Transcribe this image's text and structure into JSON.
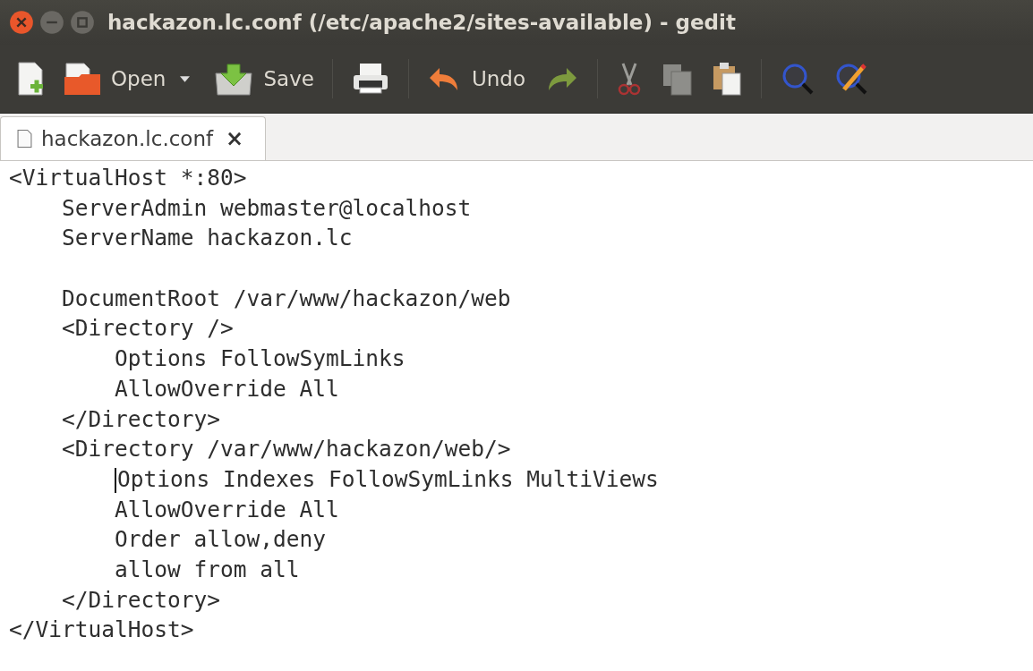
{
  "window": {
    "title": "hackazon.lc.conf (/etc/apache2/sites-available) - gedit"
  },
  "toolbar": {
    "open_label": "Open",
    "save_label": "Save",
    "undo_label": "Undo"
  },
  "tabs": [
    {
      "label": "hackazon.lc.conf",
      "selected": true,
      "close": "×"
    }
  ],
  "editor": {
    "lines": [
      {
        "text": "<VirtualHost *:80>",
        "cursor": false
      },
      {
        "text": "    ServerAdmin webmaster@localhost",
        "cursor": false
      },
      {
        "text": "    ServerName hackazon.lc",
        "cursor": false
      },
      {
        "kind": "blank"
      },
      {
        "text": "    DocumentRoot /var/www/hackazon/web",
        "cursor": false
      },
      {
        "text": "    <Directory />",
        "cursor": false
      },
      {
        "text": "        Options FollowSymLinks",
        "cursor": false
      },
      {
        "text": "        AllowOverride All",
        "cursor": false
      },
      {
        "text": "    </Directory>",
        "cursor": false
      },
      {
        "text": "    <Directory /var/www/hackazon/web/>",
        "cursor": false
      },
      {
        "text": "        Options Indexes FollowSymLinks MultiViews",
        "cursor": true
      },
      {
        "text": "        AllowOverride All",
        "cursor": false
      },
      {
        "text": "        Order allow,deny",
        "cursor": false
      },
      {
        "text": "        allow from all",
        "cursor": false
      },
      {
        "text": "    </Directory>",
        "cursor": false
      },
      {
        "text": "</VirtualHost>",
        "cursor": false
      }
    ]
  }
}
